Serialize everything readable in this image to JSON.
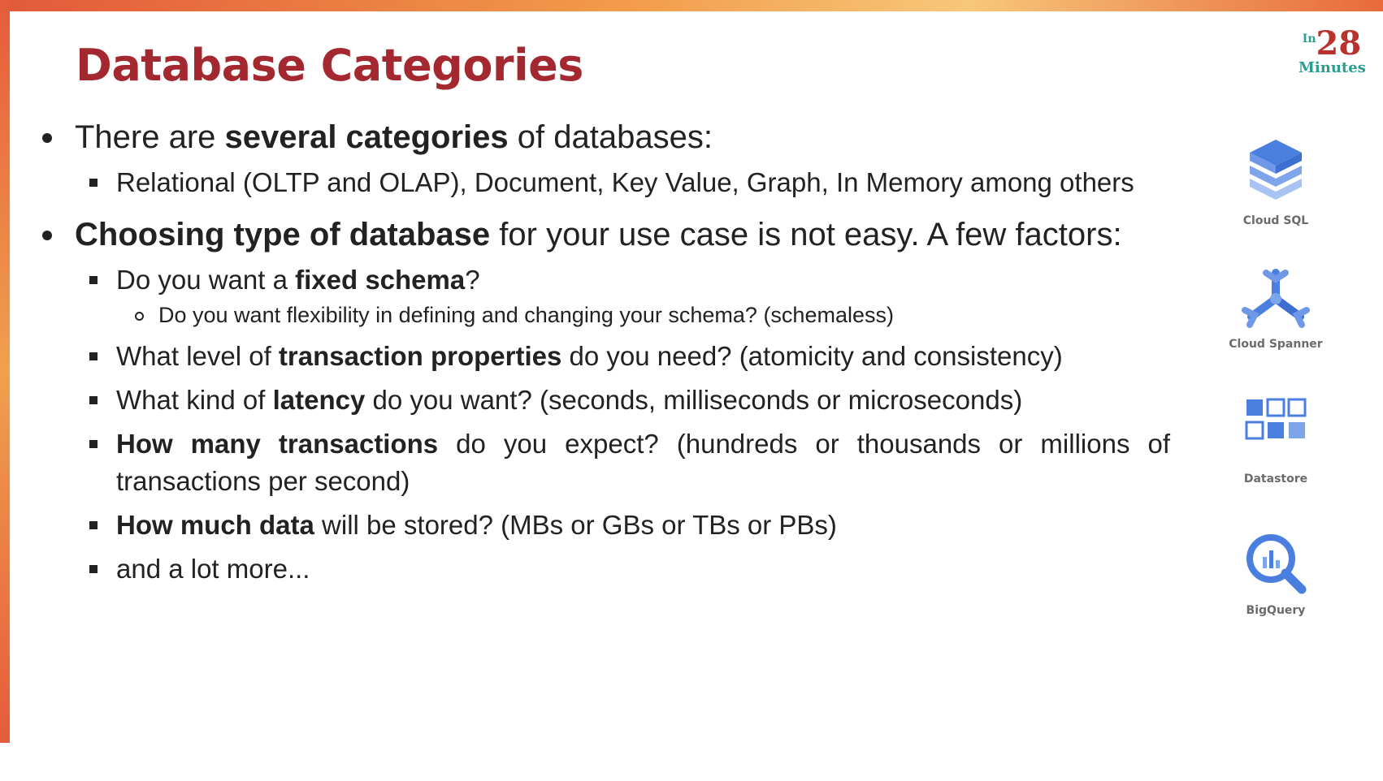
{
  "slide": {
    "title": "Database Categories",
    "logo": {
      "prefix": "In",
      "number": "28",
      "suffix": "Minutes"
    }
  },
  "bullets": {
    "b1": {
      "pre": "There are ",
      "bold": "several categories",
      "post": " of databases:",
      "sub1": "Relational (OLTP and OLAP), Document, Key Value, Graph, In Memory among others"
    },
    "b2": {
      "bold": "Choosing type of database",
      "post": " for your use case is not easy. A few factors:",
      "f1": {
        "pre": "Do you want a ",
        "bold": "fixed schema",
        "post": "?"
      },
      "f1_sub": "Do you want flexibility in defining and changing your schema? (schemaless)",
      "f2": {
        "pre": "What level of ",
        "bold": "transaction properties",
        "post": " do you need? (atomicity and consistency)"
      },
      "f3": {
        "pre": "What kind of ",
        "bold": "latency",
        "post": " do you want? (seconds, milliseconds or microseconds)"
      },
      "f4": {
        "bold": "How many transactions",
        "post": " do you expect? (hundreds or thousands or millions of transactions per second)"
      },
      "f5": {
        "bold": "How much data",
        "post": " will be stored? (MBs or GBs or TBs or PBs)"
      },
      "f6": "and a lot more..."
    }
  },
  "icons": [
    {
      "label": "Cloud SQL",
      "icon": "cloud-sql-icon"
    },
    {
      "label": "Cloud Spanner",
      "icon": "cloud-spanner-icon"
    },
    {
      "label": "Datastore",
      "icon": "datastore-icon"
    },
    {
      "label": "BigQuery",
      "icon": "bigquery-icon"
    }
  ],
  "colors": {
    "title": "#a3282f",
    "text": "#222222",
    "icon_blue": "#4a7fe0",
    "icon_light": "#9ebaf0",
    "accent_bar": "#e55b3c"
  }
}
